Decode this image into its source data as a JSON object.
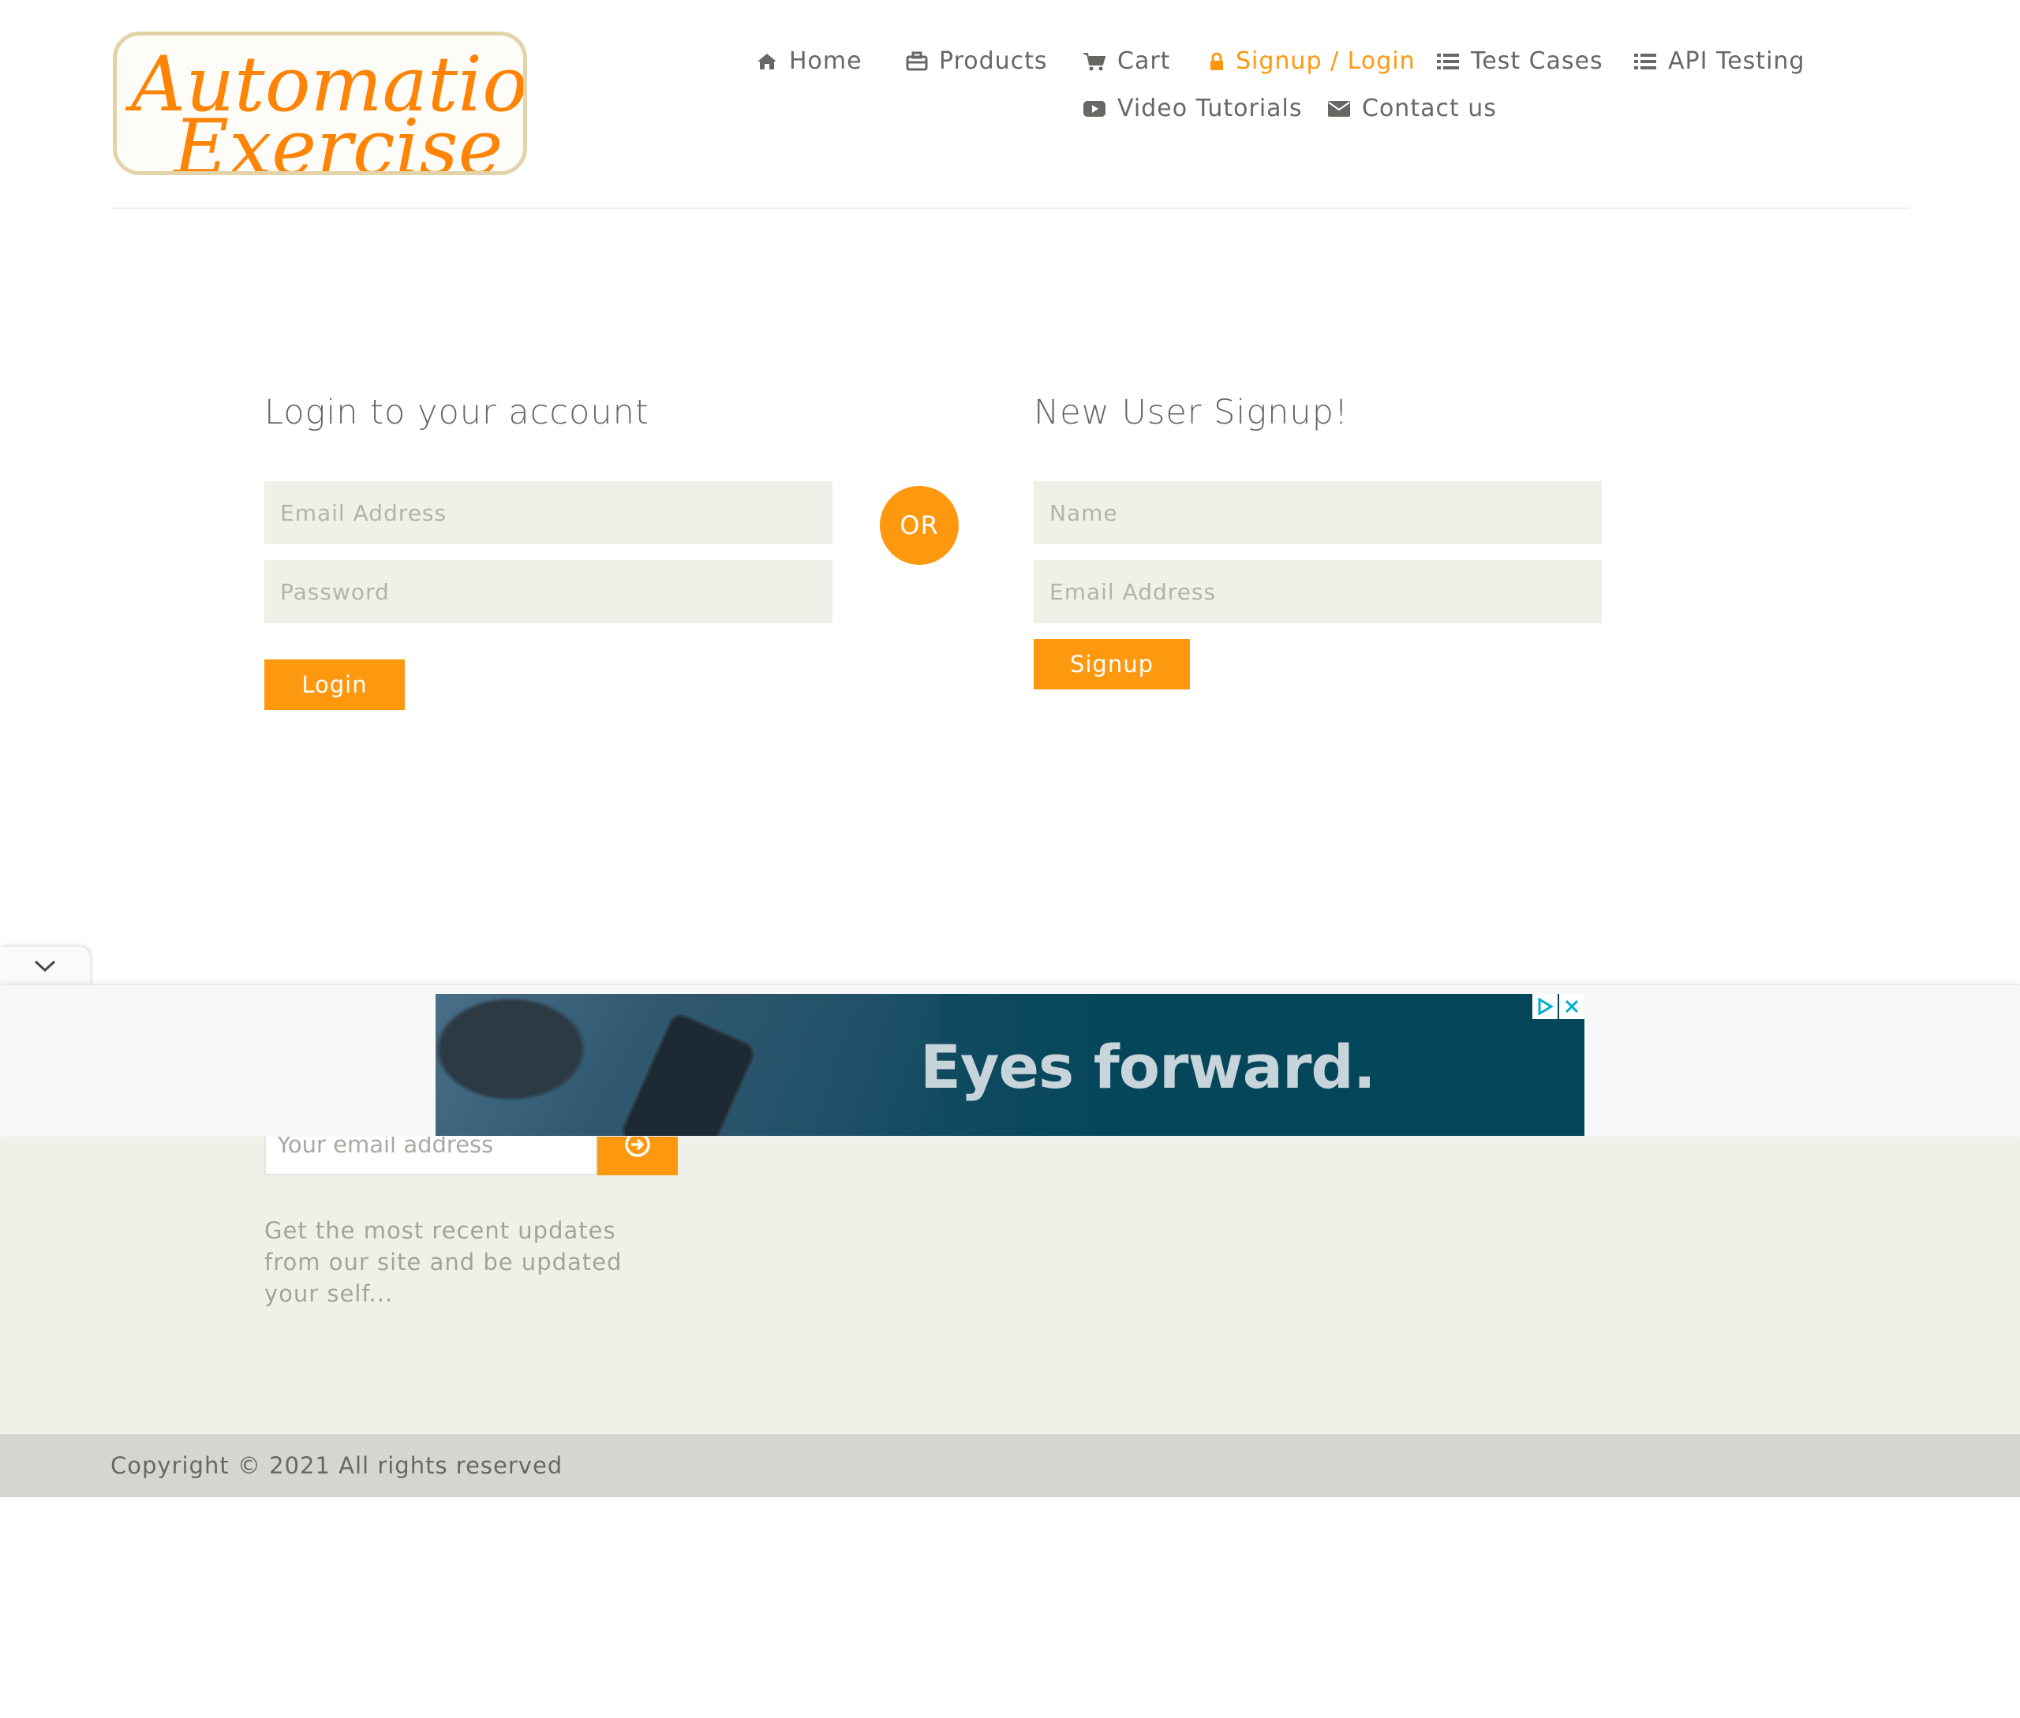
{
  "header": {
    "logo": {
      "line1": "Automation",
      "line2": "Exercise"
    },
    "nav": [
      {
        "label": "Home",
        "icon": "home-icon"
      },
      {
        "label": "Products",
        "icon": "briefcase-icon"
      },
      {
        "label": "Cart",
        "icon": "shopping-cart-icon"
      },
      {
        "label": "Signup / Login",
        "icon": "lock-icon",
        "active": true
      },
      {
        "label": "Test Cases",
        "icon": "list-icon"
      },
      {
        "label": "API Testing",
        "icon": "list-icon"
      },
      {
        "label": "Video Tutorials",
        "icon": "youtube-play-icon"
      },
      {
        "label": "Contact us",
        "icon": "envelope-icon"
      }
    ]
  },
  "login": {
    "title": "Login to your account",
    "email_placeholder": "Email Address",
    "password_placeholder": "Password",
    "button": "Login"
  },
  "or_label": "OR",
  "signup": {
    "title": "New User Signup!",
    "name_placeholder": "Name",
    "email_placeholder": "Email Address",
    "button": "Signup"
  },
  "footer": {
    "subscribe_placeholder": "Your email address",
    "subscribe_text": "Get the most recent updates from our site and be updated your self...",
    "copyright": "Copyright © 2021 All rights reserved"
  },
  "ad": {
    "headline": "Eyes forward."
  },
  "colors": {
    "accent": "#FE980F",
    "text": "#696763",
    "field_bg": "#F0F0E9",
    "footer_bottom": "#D6D6D0"
  }
}
